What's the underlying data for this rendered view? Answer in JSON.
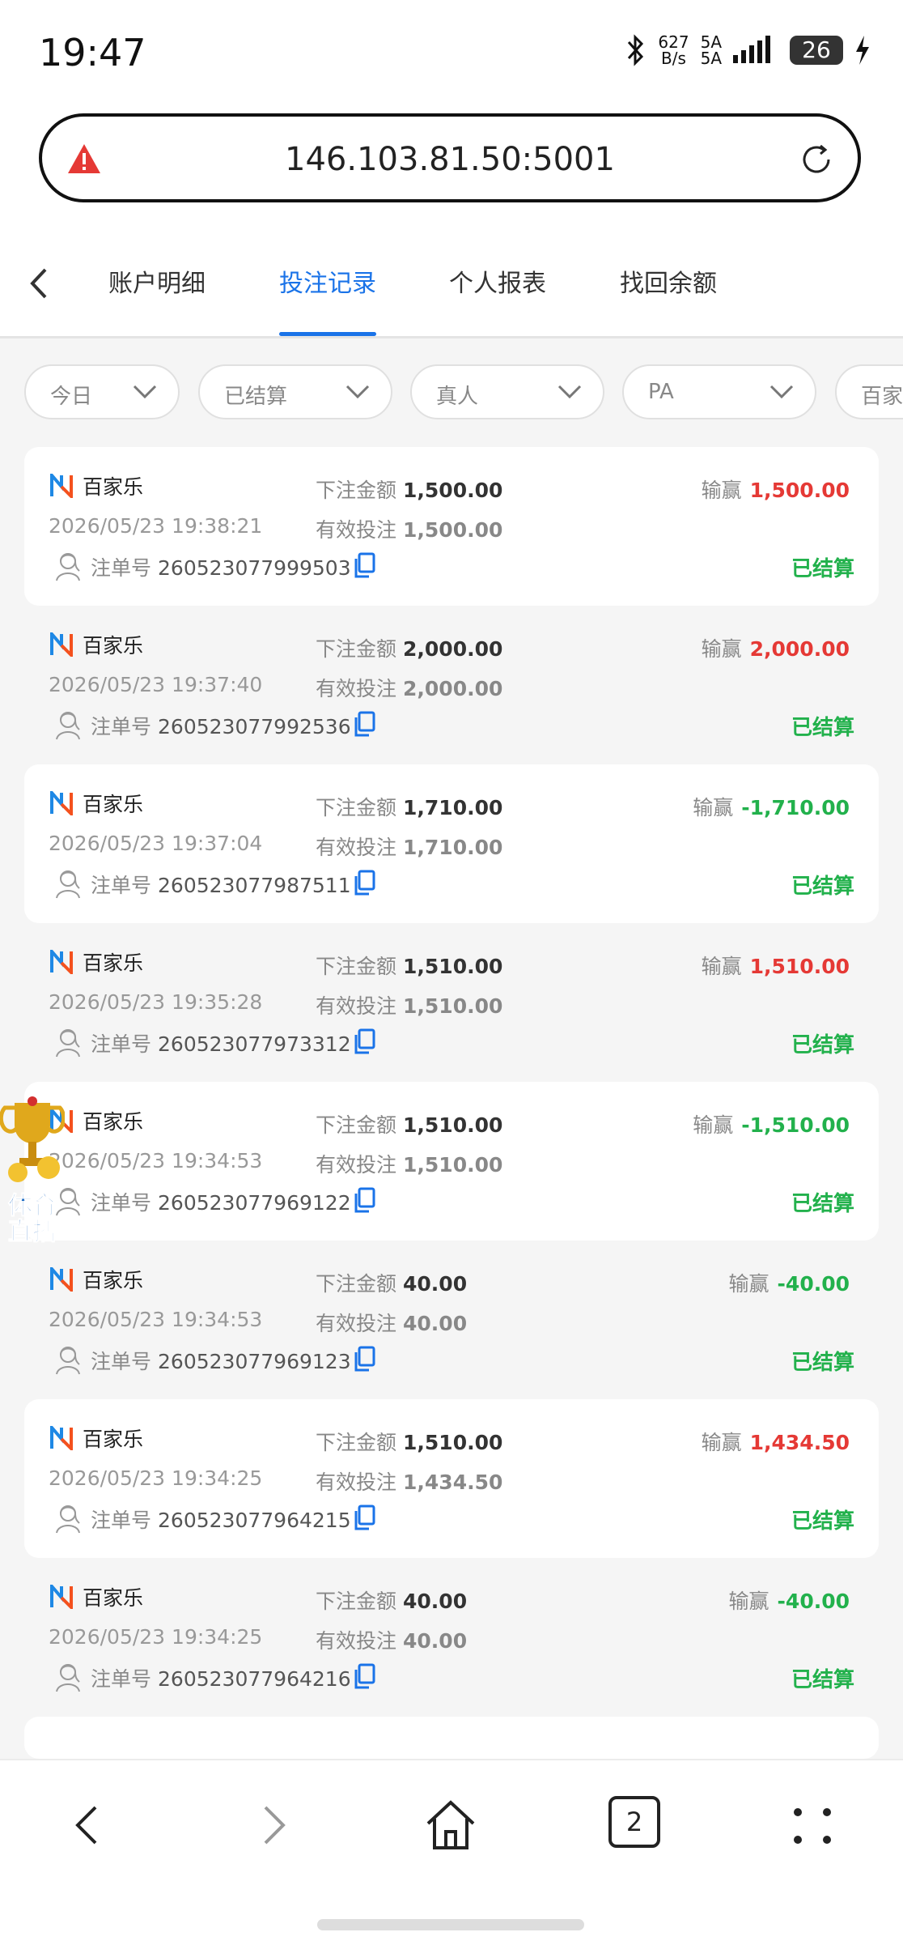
{
  "status_bar": {
    "time": "19:47",
    "net_speed_top": "627",
    "net_speed_bottom": "B/s",
    "sim1": "5A",
    "sim2": "5A",
    "battery": "26"
  },
  "address_bar": {
    "url": "146.103.81.50:5001",
    "warning_icon": "warning-icon",
    "reload_icon": "reload-icon"
  },
  "tabs": {
    "items": [
      "账户明细",
      "投注记录",
      "个人报表",
      "找回余额"
    ],
    "active": "投注记录"
  },
  "filters": [
    "今日",
    "已结算",
    "真人",
    "PA",
    "百家"
  ],
  "labels": {
    "bet_amount": "下注金额",
    "valid_bet": "有效投注",
    "win_loss": "输赢",
    "order_no": "注单号"
  },
  "records": [
    {
      "game": "百家乐",
      "bet": "1,500.00",
      "valid": "1,500.00",
      "win": "1,500.00",
      "date": "2026/05/23 19:38:21",
      "order": "260523077999503",
      "status": "已结算"
    },
    {
      "game": "百家乐",
      "bet": "2,000.00",
      "valid": "2,000.00",
      "win": "2,000.00",
      "date": "2026/05/23 19:37:40",
      "order": "260523077992536",
      "status": "已结算"
    },
    {
      "game": "百家乐",
      "bet": "1,710.00",
      "valid": "1,710.00",
      "win": "-1,710.00",
      "date": "2026/05/23 19:37:04",
      "order": "260523077987511",
      "status": "已结算"
    },
    {
      "game": "百家乐",
      "bet": "1,510.00",
      "valid": "1,510.00",
      "win": "1,510.00",
      "date": "2026/05/23 19:35:28",
      "order": "260523077973312",
      "status": "已结算"
    },
    {
      "game": "百家乐",
      "bet": "1,510.00",
      "valid": "1,510.00",
      "win": "-1,510.00",
      "date": "2026/05/23 19:34:53",
      "order": "260523077969122",
      "status": "已结算"
    },
    {
      "game": "百家乐",
      "bet": "40.00",
      "valid": "40.00",
      "win": "-40.00",
      "date": "2026/05/23 19:34:53",
      "order": "260523077969123",
      "status": "已结算"
    },
    {
      "game": "百家乐",
      "bet": "1,510.00",
      "valid": "1,434.50",
      "win": "1,434.50",
      "date": "2026/05/23 19:34:25",
      "order": "260523077964215",
      "status": "已结算"
    },
    {
      "game": "百家乐",
      "bet": "40.00",
      "valid": "40.00",
      "win": "-40.00",
      "date": "2026/05/23 19:34:25",
      "order": "260523077964216",
      "status": "已结算"
    }
  ],
  "floating_badge": {
    "line1": "体育",
    "line2": "直播"
  },
  "bottom_nav": {
    "tab_count": "2"
  },
  "colors": {
    "accent": "#1a73e8",
    "win": "#e53935",
    "loss": "#22b14c",
    "settled": "#22b14c"
  }
}
